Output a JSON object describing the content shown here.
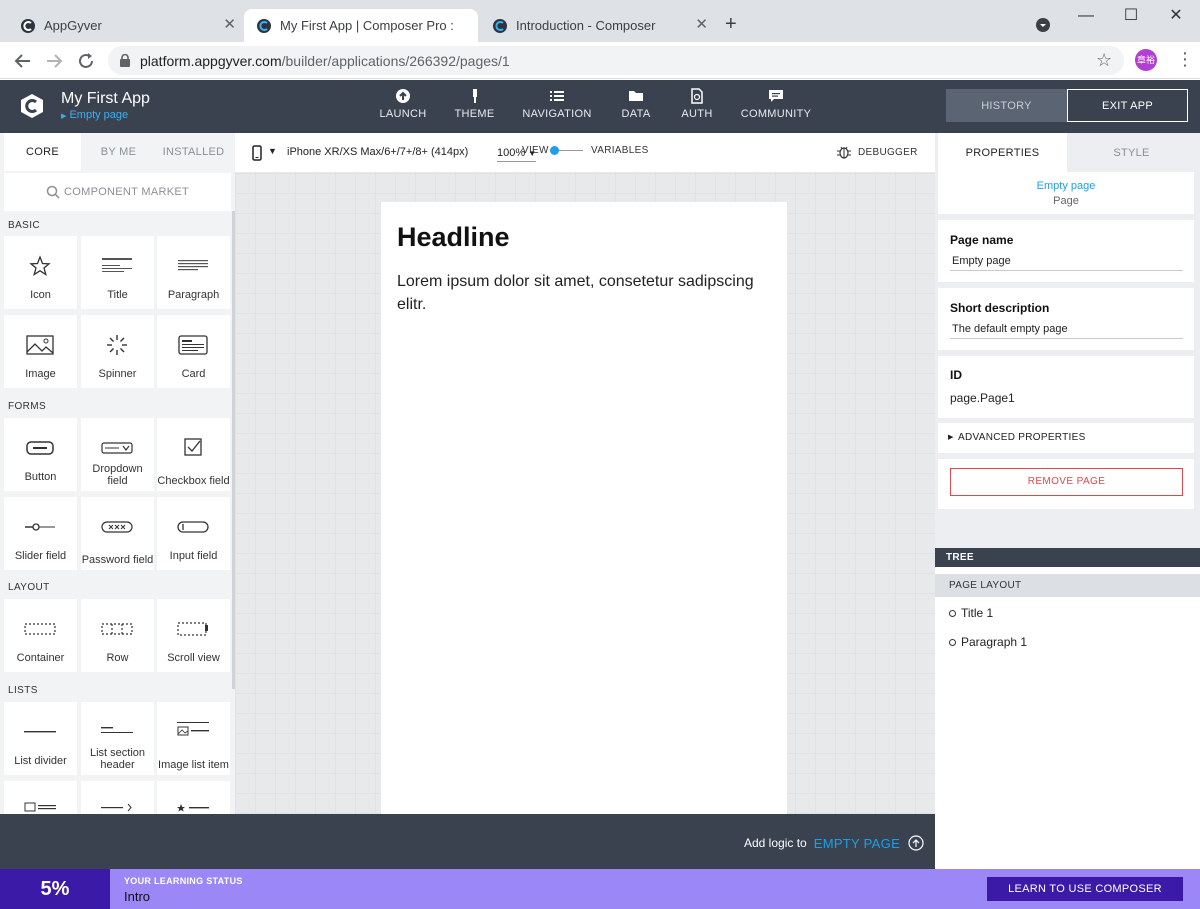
{
  "browser": {
    "tabs": [
      {
        "title": "AppGyver"
      },
      {
        "title": "My First App | Composer Pro : pl"
      },
      {
        "title": "Introduction - Composer"
      }
    ],
    "url_host": "platform.appgyver.com",
    "url_path": "/builder/applications/266392/pages/1",
    "profile_initials": "章裕"
  },
  "header": {
    "app_name": "My First App",
    "page_link": "Empty page",
    "nav": [
      {
        "label": "LAUNCH",
        "icon": "launch-icon"
      },
      {
        "label": "THEME",
        "icon": "theme-brush-icon"
      },
      {
        "label": "NAVIGATION",
        "icon": "list-icon"
      },
      {
        "label": "DATA",
        "icon": "folder-icon"
      },
      {
        "label": "AUTH",
        "icon": "auth-document-icon"
      },
      {
        "label": "COMMUNITY",
        "icon": "chat-icon"
      }
    ],
    "history_label": "HISTORY",
    "exit_label": "EXIT APP"
  },
  "left_panel": {
    "tabs": [
      "CORE",
      "BY ME",
      "INSTALLED"
    ],
    "market_label": "COMPONENT MARKET",
    "sections": [
      {
        "title": "BASIC",
        "items": [
          {
            "label": "Icon",
            "icon": "star-icon"
          },
          {
            "label": "Title",
            "icon": "title-lines-icon"
          },
          {
            "label": "Paragraph",
            "icon": "paragraph-lines-icon"
          },
          {
            "label": "Image",
            "icon": "image-icon"
          },
          {
            "label": "Spinner",
            "icon": "spinner-icon"
          },
          {
            "label": "Card",
            "icon": "card-icon"
          }
        ]
      },
      {
        "title": "FORMS",
        "items": [
          {
            "label": "Button",
            "icon": "button-icon"
          },
          {
            "label": "Dropdown field",
            "icon": "dropdown-icon"
          },
          {
            "label": "Checkbox field",
            "icon": "checkbox-icon"
          },
          {
            "label": "Slider field",
            "icon": "slider-icon"
          },
          {
            "label": "Password field",
            "icon": "password-icon"
          },
          {
            "label": "Input field",
            "icon": "input-icon"
          }
        ]
      },
      {
        "title": "LAYOUT",
        "items": [
          {
            "label": "Container",
            "icon": "container-icon"
          },
          {
            "label": "Row",
            "icon": "row-icon"
          },
          {
            "label": "Scroll view",
            "icon": "scroll-view-icon"
          }
        ]
      },
      {
        "title": "LISTS",
        "items": [
          {
            "label": "List divider",
            "icon": "list-divider-icon"
          },
          {
            "label": "List section header",
            "icon": "list-section-header-icon"
          },
          {
            "label": "Image list item",
            "icon": "image-list-item-icon"
          }
        ]
      }
    ]
  },
  "canvas": {
    "device": "iPhone XR/XS Max/6+/7+/8+ (414px)",
    "zoom": "100%",
    "view_label": "VIEW",
    "variables_label": "VARIABLES",
    "debugger_label": "DEBUGGER",
    "headline": "Headline",
    "paragraph": "Lorem ipsum dolor sit amet, consetetur sadipscing elitr."
  },
  "right_panel": {
    "tabs": [
      "PROPERTIES",
      "STYLE"
    ],
    "selected_name": "Empty page",
    "selected_type": "Page",
    "page_name_label": "Page name",
    "page_name_value": "Empty page",
    "short_desc_label": "Short description",
    "short_desc_value": "The default empty page",
    "id_label": "ID",
    "id_value": "page.Page1",
    "advanced_label": "ADVANCED PROPERTIES",
    "remove_label": "REMOVE PAGE",
    "tree_label": "TREE",
    "page_layout_label": "PAGE LAYOUT",
    "tree_items": [
      "Title 1",
      "Paragraph 1"
    ]
  },
  "bottom": {
    "add_logic_prefix": "Add logic to",
    "add_logic_target": "EMPTY PAGE"
  },
  "learning": {
    "percent": "5%",
    "status_label": "YOUR LEARNING STATUS",
    "status_value": "Intro",
    "button_label": "LEARN TO USE COMPOSER"
  },
  "colors": {
    "header_bg": "#3a4250",
    "accent_blue": "#1ea0e6",
    "learn_bg": "#9b87f5",
    "learn_dark": "#3b1aa8",
    "remove_red": "#e0474c"
  }
}
